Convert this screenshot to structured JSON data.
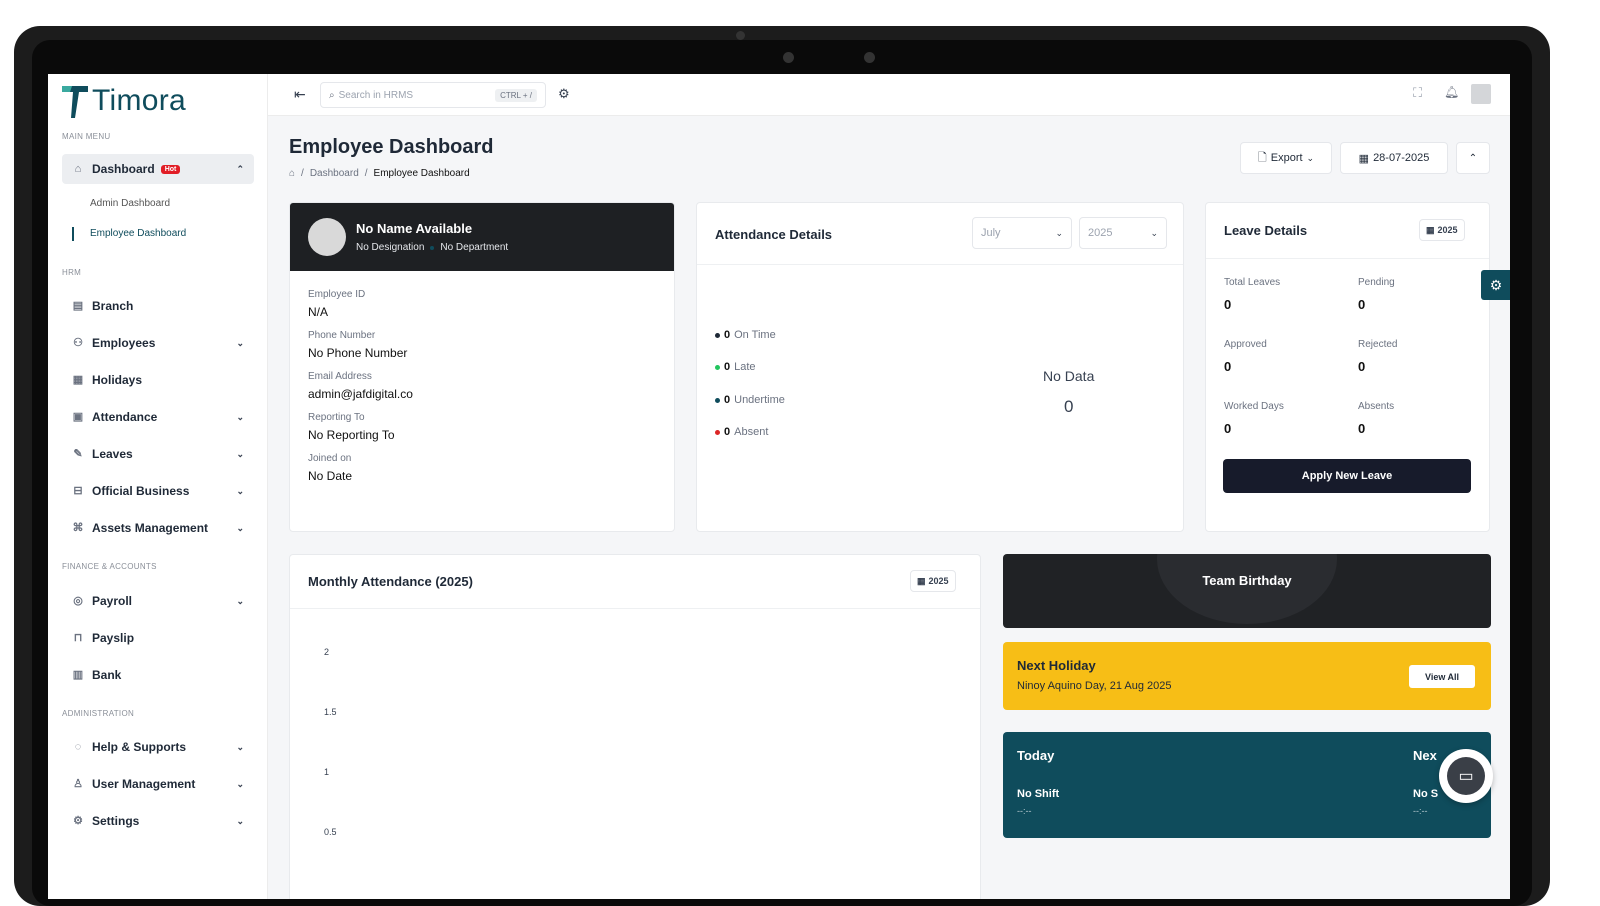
{
  "app": {
    "logo": "Timora"
  },
  "sidebar": {
    "sections": {
      "main": "MAIN MENU",
      "hrm": "HRM",
      "finance": "FINANCE & ACCOUNTS",
      "admin": "ADMINISTRATION"
    },
    "dashboard": {
      "label": "Dashboard",
      "badge": "Hot",
      "subs": [
        "Admin Dashboard",
        "Employee Dashboard"
      ]
    },
    "items": [
      "Branch",
      "Employees",
      "Holidays",
      "Attendance",
      "Leaves",
      "Official Business",
      "Assets Management",
      "Payroll",
      "Payslip",
      "Bank",
      "Help & Supports",
      "User Management",
      "Settings"
    ]
  },
  "topbar": {
    "search_placeholder": "Search in HRMS",
    "shortcut": "CTRL + /"
  },
  "header": {
    "title": "Employee Dashboard",
    "breadcrumb": [
      "Dashboard",
      "Employee Dashboard"
    ],
    "export_label": "Export",
    "date": "28-07-2025"
  },
  "employee": {
    "name": "No Name Available",
    "designation": "No Designation",
    "department": "No Department",
    "fields": [
      {
        "label": "Employee ID",
        "value": "N/A"
      },
      {
        "label": "Phone Number",
        "value": "No Phone Number"
      },
      {
        "label": "Email Address",
        "value": "admin@jafdigital.co"
      },
      {
        "label": "Reporting To",
        "value": "No Reporting To"
      },
      {
        "label": "Joined on",
        "value": "No Date"
      }
    ]
  },
  "attendance": {
    "title": "Attendance Details",
    "month": "July",
    "year": "2025",
    "legend": [
      {
        "count": "0",
        "label": "On Time",
        "color": "#1f2937"
      },
      {
        "count": "0",
        "label": "Late",
        "color": "#22c55e"
      },
      {
        "count": "0",
        "label": "Undertime",
        "color": "#0f4c5c"
      },
      {
        "count": "0",
        "label": "Absent",
        "color": "#dc2626"
      }
    ],
    "no_data": "No Data",
    "total": "0"
  },
  "leave": {
    "title": "Leave Details",
    "year": "2025",
    "stats": [
      {
        "label": "Total Leaves",
        "value": "0"
      },
      {
        "label": "Pending",
        "value": "0"
      },
      {
        "label": "Approved",
        "value": "0"
      },
      {
        "label": "Rejected",
        "value": "0"
      },
      {
        "label": "Worked Days",
        "value": "0"
      },
      {
        "label": "Absents",
        "value": "0"
      }
    ],
    "apply_label": "Apply New Leave"
  },
  "monthly": {
    "title": "Monthly Attendance (2025)",
    "year": "2025"
  },
  "chart_data": {
    "type": "bar",
    "title": "Monthly Attendance (2025)",
    "yticks": [
      "2",
      "1.5",
      "1",
      "0.5"
    ],
    "series": []
  },
  "birthday": {
    "title": "Team Birthday"
  },
  "holiday": {
    "title": "Next Holiday",
    "detail": "Ninoy Aquino Day, 21 Aug 2025",
    "button": "View All"
  },
  "today": {
    "title": "Today",
    "next": "Nex",
    "shift": "No Shift",
    "shift_time": "--:--",
    "next_shift": "No S",
    "next_time": "--:--"
  }
}
